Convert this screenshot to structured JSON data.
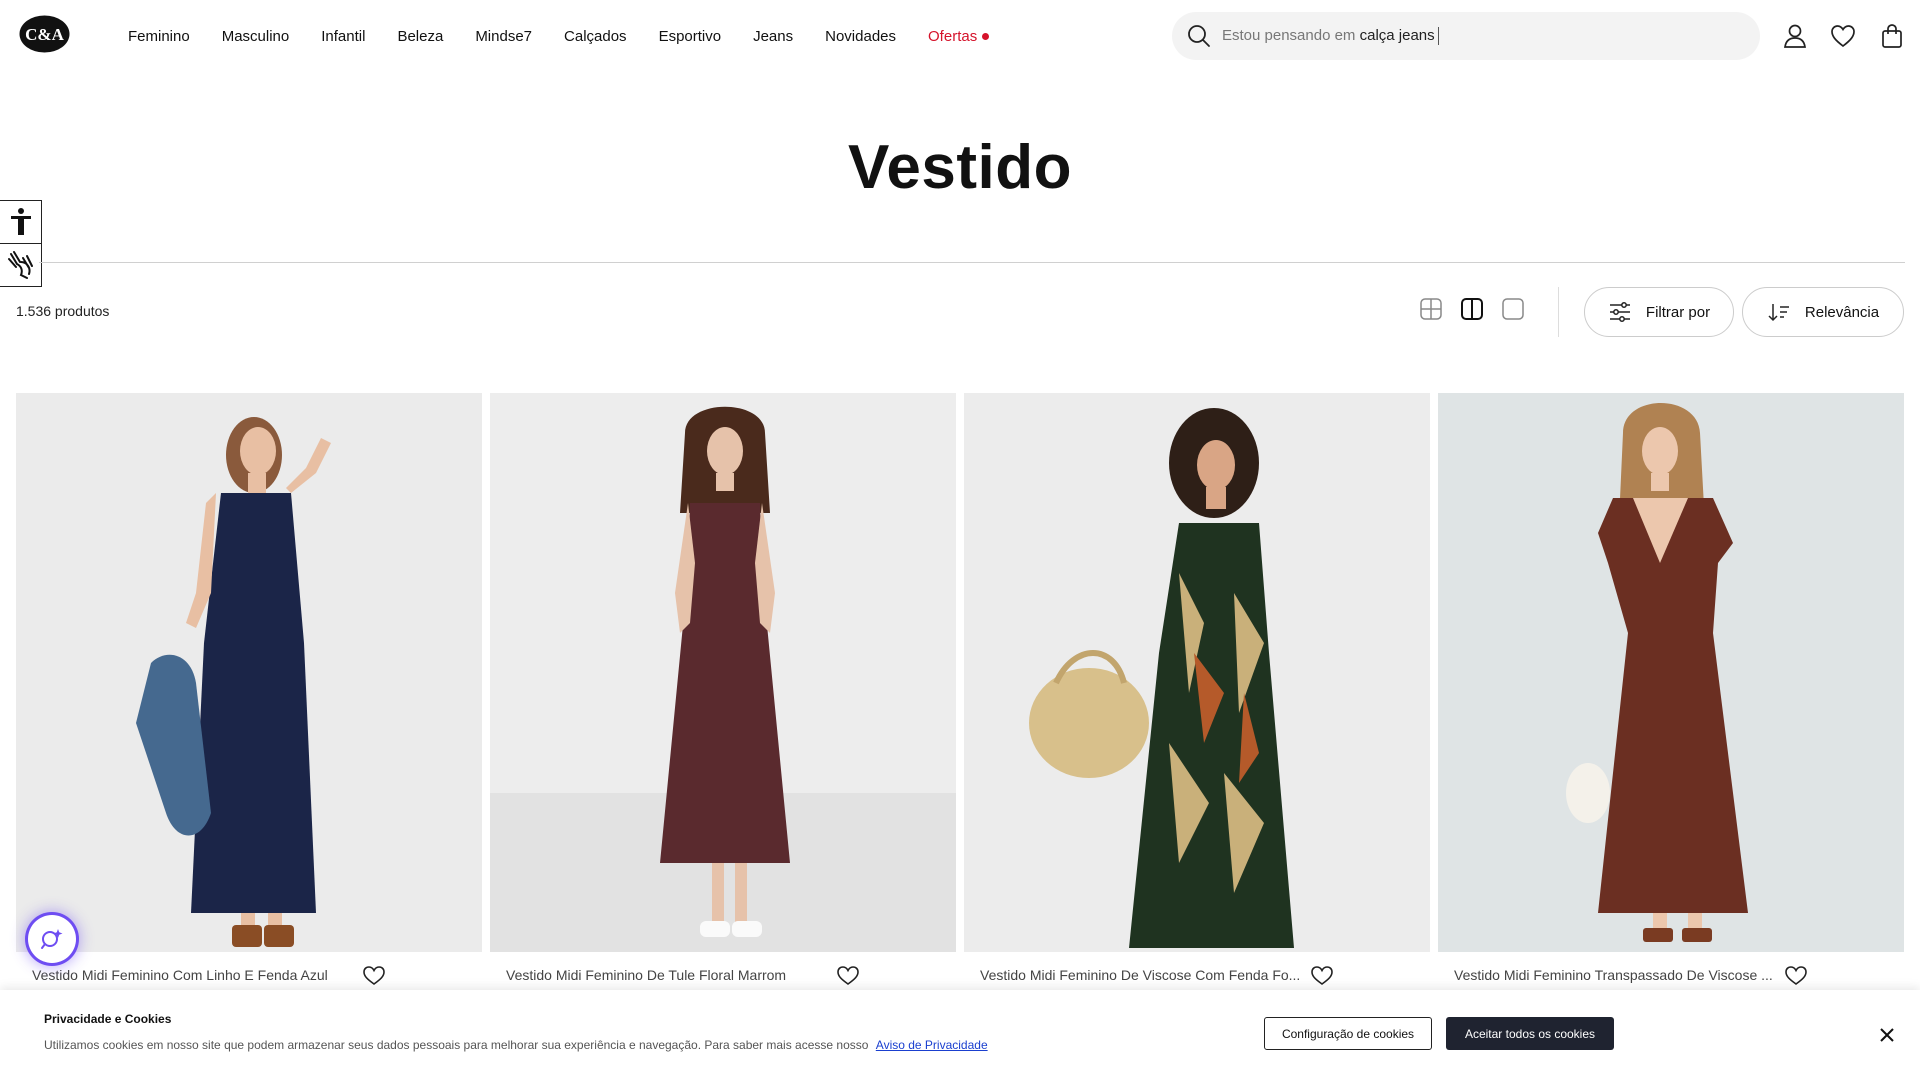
{
  "header": {
    "logo_text": "C&A",
    "nav": [
      {
        "label": "Feminino"
      },
      {
        "label": "Masculino"
      },
      {
        "label": "Infantil"
      },
      {
        "label": "Beleza"
      },
      {
        "label": "Mindse7"
      },
      {
        "label": "Calçados"
      },
      {
        "label": "Esportivo"
      },
      {
        "label": "Jeans"
      },
      {
        "label": "Novidades"
      },
      {
        "label": "Ofertas"
      }
    ],
    "search": {
      "prefix": "Estou pensando em",
      "suggestion": "calça jeans"
    },
    "icons": [
      "user-icon",
      "heart-icon",
      "bag-icon"
    ]
  },
  "page": {
    "title": "Vestido",
    "product_count": "1.536 produtos",
    "filter_label": "Filtrar por",
    "sort_label": "Relevância",
    "view_modes": [
      "grid-4-icon",
      "grid-2-icon",
      "grid-1-icon"
    ],
    "active_view": "grid-2-icon"
  },
  "products": [
    {
      "name": "Vestido Midi Feminino Com Linho E Fenda Azul",
      "dress_color": "#1b2548",
      "bg": "#ebebeb"
    },
    {
      "name": "Vestido Midi Feminino De Tule Floral Marrom",
      "dress_color": "#5a2a2e",
      "bg": "#ededed"
    },
    {
      "name": "Vestido Midi Feminino De Viscose Com Fenda Fo...",
      "dress_color": "#1f3320",
      "bg": "#ececec"
    },
    {
      "name": "Vestido Midi Feminino Transpassado De Viscose ...",
      "dress_color": "#6b2f22",
      "bg": "#dfe4e5"
    }
  ],
  "cookie": {
    "title": "Privacidade e Cookies",
    "text": "Utilizamos cookies em nosso site que podem armazenar seus dados pessoais para melhorar sua experiência e navegação. Para saber mais acesse nosso",
    "link": "Aviso de Privacidade",
    "config_button": "Configuração de cookies",
    "accept_button": "Aceitar todos os cookies"
  },
  "colors": {
    "accent_offers": "#d5132b",
    "ai_glow": "#6e4df2",
    "cookie_accept_bg": "#1f2330"
  }
}
